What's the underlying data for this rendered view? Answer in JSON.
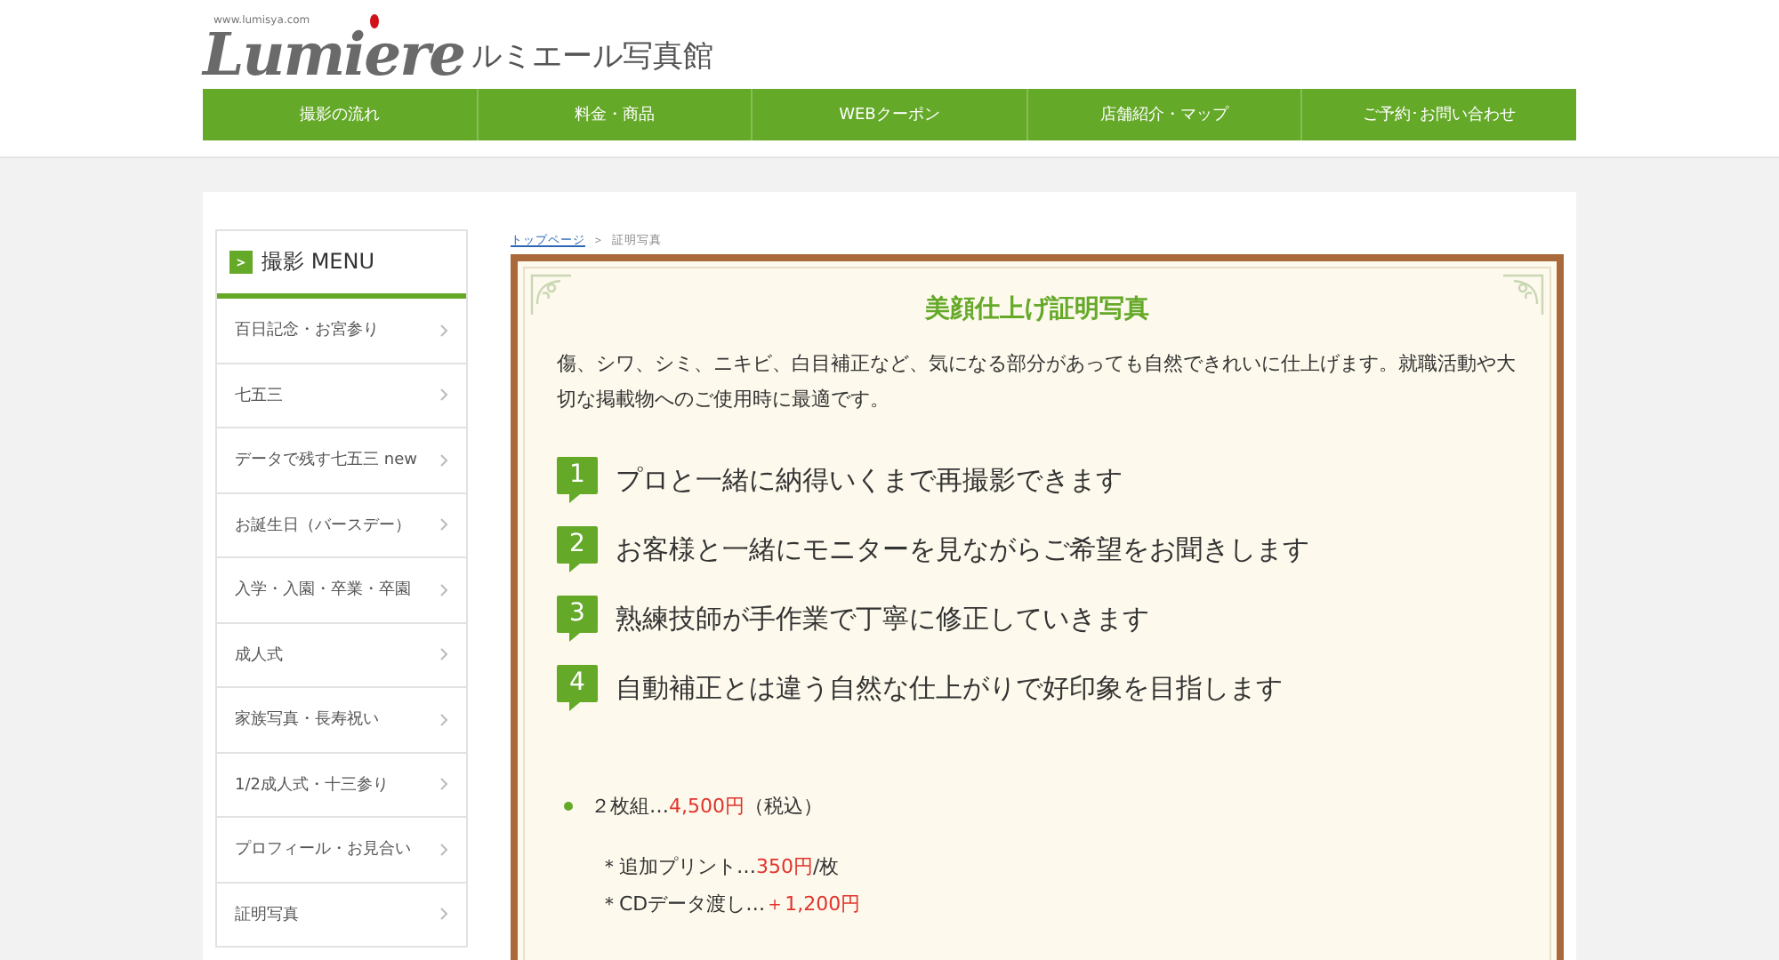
{
  "header": {
    "logo": {
      "url": "www.lumisya.com",
      "wordmark": "Lumiere",
      "name": "ルミエール写真館"
    },
    "nav": [
      {
        "label": "撮影の流れ"
      },
      {
        "label": "料金・商品"
      },
      {
        "label": "WEBクーポン"
      },
      {
        "label": "店舗紹介・マップ"
      },
      {
        "label": "ご予約･お問い合わせ"
      }
    ]
  },
  "sidebar": {
    "heading_icon": "＞",
    "heading": "撮影 MENU",
    "items": [
      {
        "label": "百日記念・お宮参り",
        "selected": false
      },
      {
        "label": "七五三",
        "selected": false
      },
      {
        "label": "データで残す七五三 new",
        "selected": false
      },
      {
        "label": "お誕生日（バースデー）",
        "selected": false
      },
      {
        "label": "入学・入園・卒業・卒園",
        "selected": false
      },
      {
        "label": "成人式",
        "selected": false
      },
      {
        "label": "家族写真・長寿祝い",
        "selected": false
      },
      {
        "label": "1/2成人式・十三参り",
        "selected": false
      },
      {
        "label": "プロフィール・お見合い",
        "selected": false
      },
      {
        "label": "証明写真",
        "selected": false
      }
    ]
  },
  "breadcrumb": [
    {
      "label": "トップページ",
      "kind": "link"
    },
    {
      "label": "＞",
      "kind": "separator"
    },
    {
      "label": "証明写真",
      "kind": "current"
    }
  ],
  "content": {
    "title": "美顔仕上げ証明写真",
    "intro": "傷、シワ、シミ、ニキビ、白目補正など、気になる部分があっても自然できれいに仕上げます。就職活動や大切な掲載物へのご使用時に最適です。",
    "steps": [
      {
        "number": "1",
        "text": "プロと一緒に納得いくまで再撮影できます"
      },
      {
        "number": "2",
        "text": "お客様と一緒にモニターを見ながらご希望をお聞きします"
      },
      {
        "number": "3",
        "text": "熟練技師が手作業で丁寧に修正していきます"
      },
      {
        "number": "4",
        "text": "自動補正とは違う自然な仕上がりで好印象を目指します"
      }
    ],
    "price": {
      "label": "２枚組…",
      "amount": "4,500円",
      "note": "（税込）"
    },
    "options": [
      {
        "label": "＊追加プリント…",
        "amount": "350円",
        "note": "/枚"
      },
      {
        "label": "＊CDデータ渡し…",
        "amount": "＋1,200円"
      }
    ]
  }
}
